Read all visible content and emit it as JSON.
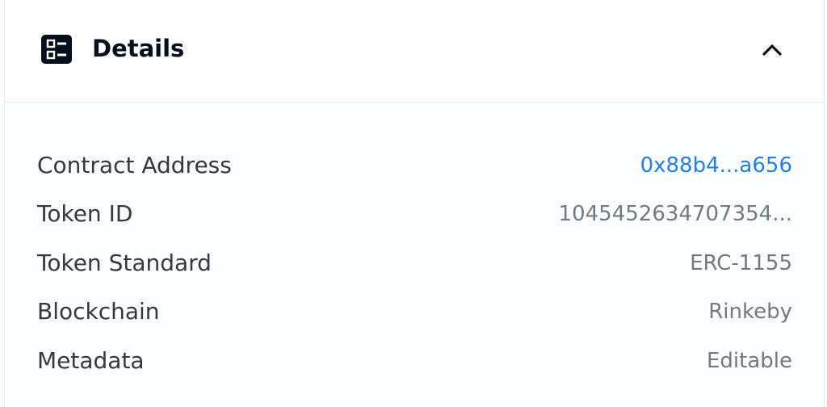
{
  "header": {
    "title": "Details",
    "icon": "details-icon",
    "toggle_icon": "chevron-up-icon"
  },
  "details": [
    {
      "label": "Contract Address",
      "value": "0x88b4...a656"
    },
    {
      "label": "Token ID",
      "value": "1045452634707354..."
    },
    {
      "label": "Token Standard",
      "value": "ERC-1155"
    },
    {
      "label": "Blockchain",
      "value": "Rinkeby"
    },
    {
      "label": "Metadata",
      "value": "Editable"
    }
  ],
  "colors": {
    "link": "#2081e2",
    "label": "#353840",
    "value": "#707a83",
    "title": "#04111d",
    "body_bg": "#fbfdff",
    "border": "#e5e8eb"
  }
}
